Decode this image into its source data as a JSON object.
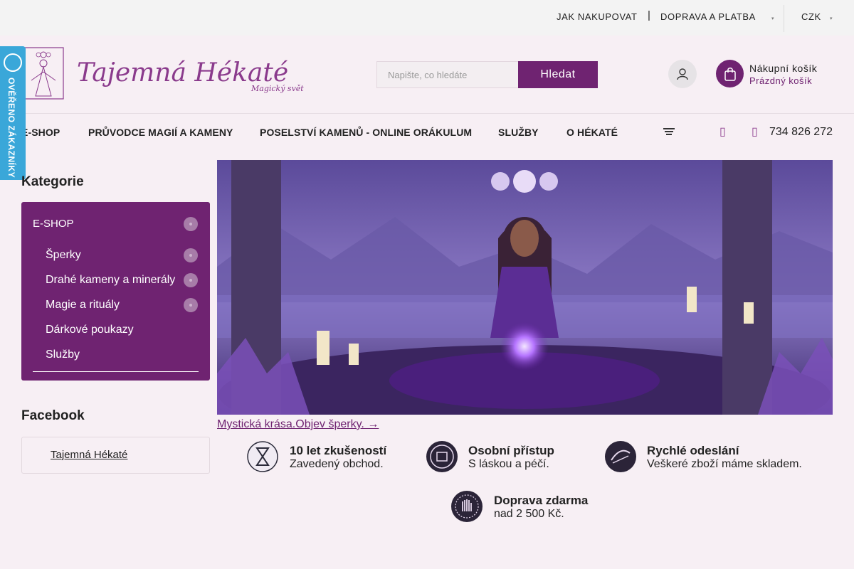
{
  "topbar": {
    "links": [
      "JAK NAKUPOVAT",
      "DOPRAVA A PLATBA"
    ],
    "separator": "|",
    "currency": "CZK"
  },
  "header": {
    "logo_title": "Tajemná Hékaté",
    "logo_tagline": "Magický svět",
    "search": {
      "placeholder": "Napište, co hledáte",
      "button": "Hledat"
    },
    "cart": {
      "title": "Nákupní košík",
      "status": "Prázdný košík"
    }
  },
  "nav": {
    "items": [
      "E-SHOP",
      "PRŮVODCE MAGIÍ A KAMENY",
      "POSELSTVÍ KAMENŮ - ONLINE ORÁKULUM",
      "SLUŽBY",
      "O HÉKATÉ"
    ],
    "phone": "734 826 272"
  },
  "badge": {
    "text": "OVĚŘENO ZÁKAZNÍKY"
  },
  "sidebar": {
    "categories_title": "Kategorie",
    "root": "E-SHOP",
    "items": [
      "Šperky",
      "Drahé kameny a minerály",
      "Magie a rituály",
      "Dárkové poukazy",
      "Služby"
    ],
    "facebook_title": "Facebook",
    "facebook_link": "Tajemná Hékaté"
  },
  "banner": {
    "caption": "Mystická krása.Objev šperky. →"
  },
  "benefits": [
    {
      "title": "10 let zkušeností",
      "subtitle": "Zavedený obchod."
    },
    {
      "title": "Osobní přístup",
      "subtitle": "S láskou a péčí."
    },
    {
      "title": "Rychlé odeslání",
      "subtitle": "Veškeré zboží máme skladem."
    },
    {
      "title": "Doprava zdarma",
      "subtitle": "nad 2 500 Kč."
    }
  ],
  "colors": {
    "brand": "#6f2371",
    "badge": "#3aa7d9",
    "background": "#f7eff4"
  }
}
